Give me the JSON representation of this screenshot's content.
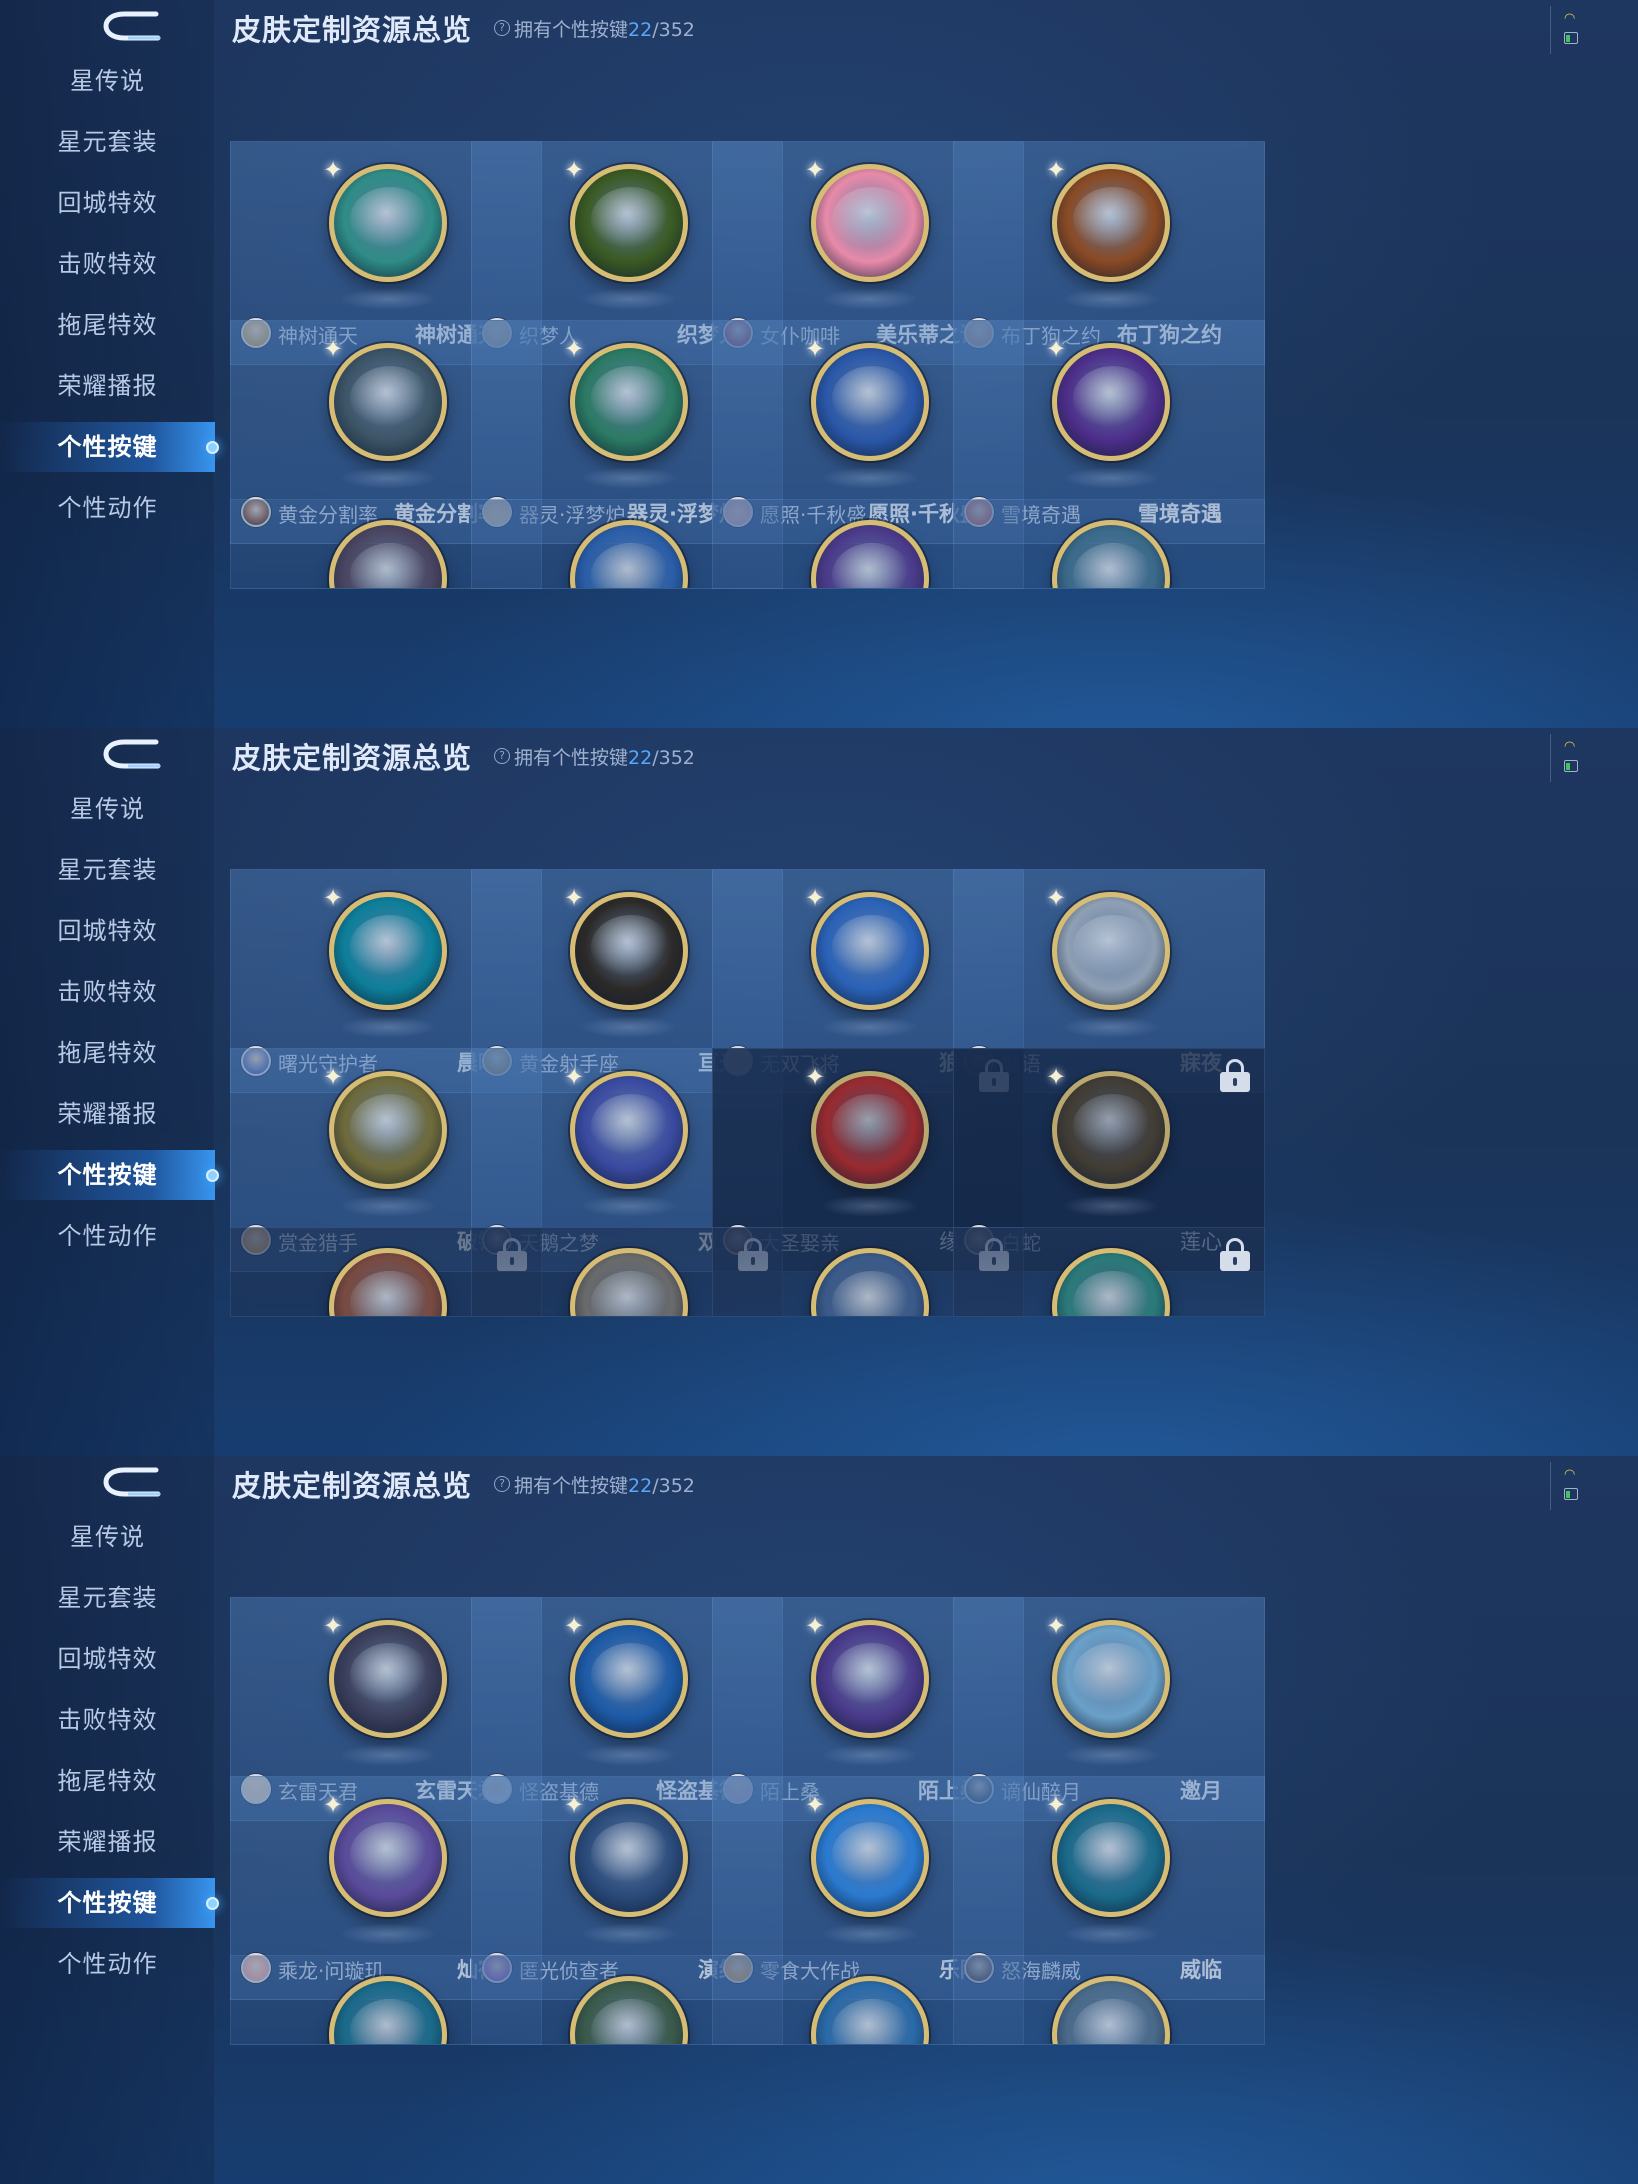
{
  "header": {
    "title": "皮肤定制资源总览",
    "help_icon": "question-icon",
    "owned_prefix": "拥有个性按键",
    "owned_count": "22",
    "owned_total": "/352"
  },
  "sidebar": {
    "back_icon": "back-arrow-icon",
    "items": [
      {
        "label": "星传说"
      },
      {
        "label": "星元套装"
      },
      {
        "label": "回城特效"
      },
      {
        "label": "击败特效"
      },
      {
        "label": "拖尾特效"
      },
      {
        "label": "荣耀播报"
      },
      {
        "label": "个性按键",
        "active": true
      },
      {
        "label": "个性动作"
      }
    ]
  },
  "status_bar": {
    "wifi_icon": "wifi-icon",
    "battery_icon": "battery-icon"
  },
  "screens": [
    {
      "cards": [
        {
          "hero": "神树通天",
          "skin": "神树通天",
          "icon": "winged-staff-icon",
          "medal": "#2f8c86",
          "avatar": "#c9a55a",
          "locked": false
        },
        {
          "hero": "织梦人",
          "skin": "织梦人",
          "icon": "golden-dragon-icon",
          "medal": "#3a5a22",
          "avatar": "#d4b48a",
          "locked": false
        },
        {
          "hero": "女仆咖啡",
          "skin": "美乐蒂之语",
          "icon": "melody-bunny-icon",
          "medal": "#e88aa9",
          "avatar": "#c0304a",
          "locked": false
        },
        {
          "hero": "布丁狗之约",
          "skin": "布丁狗之约",
          "icon": "pudding-bow-icon",
          "medal": "#8a4a24",
          "avatar": "#e39a7a",
          "locked": false
        },
        {
          "hero": "黄金分割率",
          "skin": "黄金分割率",
          "icon": "compass-ruler-icon",
          "medal": "#3c5466",
          "avatar": "#7b4a34",
          "locked": false
        },
        {
          "hero": "器灵·浮梦炉",
          "skin": "器灵·浮梦炉",
          "icon": "golden-censer-icon",
          "medal": "#2b7a63",
          "avatar": "#e3d2b0",
          "locked": false
        },
        {
          "hero": "愿照·千秋盛",
          "skin": "愿照·千秋盛",
          "icon": "pinwheel-icon",
          "medal": "#2a57a8",
          "avatar": "#e0b4c0",
          "locked": false
        },
        {
          "hero": "雪境奇遇",
          "skin": "雪境奇遇",
          "icon": "purple-flower-icon",
          "medal": "#4d2e8a",
          "avatar": "#d96b6b",
          "locked": false
        }
      ],
      "peek": [
        {
          "icon": "golden-spear-icon",
          "medal": "#4a4560",
          "locked": false
        },
        {
          "icon": "gauntlet-icon",
          "medal": "#2a5ea8",
          "locked": false
        },
        {
          "icon": "purple-dragon-icon",
          "medal": "#4b3a8a",
          "locked": false
        },
        {
          "icon": "trident-icon",
          "medal": "#3a6a8a",
          "locked": false
        }
      ]
    },
    {
      "cards": [
        {
          "hero": "曙光守护者",
          "skin": "晨晖",
          "icon": "blue-axe-icon",
          "medal": "#0d7f9a",
          "avatar": "#5a6ab0",
          "locked": false
        },
        {
          "hero": "黄金射手座",
          "skin": "亘光",
          "icon": "golden-bow-icon",
          "medal": "#2c2a28",
          "avatar": "#b88a3a",
          "locked": false
        },
        {
          "hero": "无双飞将",
          "skin": "狼魂",
          "icon": "spear-blade-icon",
          "medal": "#2a62b8",
          "avatar": "#e6e6f0",
          "locked": false
        },
        {
          "hero": "魅语",
          "skin": "寐夜",
          "icon": "folding-fan-icon",
          "medal": "#8fa0b4",
          "avatar": "#5a4a58",
          "locked": false
        },
        {
          "hero": "赏金猎手",
          "skin": "破锋",
          "icon": "golden-blade-icon",
          "medal": "#6e6a3a",
          "avatar": "#c8a06a",
          "locked": false
        },
        {
          "hero": "天鹅之梦",
          "skin": "双生",
          "icon": "swan-moon-icon",
          "medal": "#3a4aa0",
          "avatar": "#3a4a8a",
          "locked": false
        },
        {
          "hero": "大圣娶亲",
          "skin": "缘起",
          "icon": "red-scroll-icon",
          "medal": "#b02a2a",
          "avatar": "#9a4a34",
          "locked": true
        },
        {
          "hero": "白蛇",
          "skin": "莲心",
          "icon": "lotus-icon",
          "medal": "#4a4030",
          "avatar": "#6a5a50",
          "locked": true
        }
      ],
      "peek": [
        {
          "icon": "compass-icon",
          "medal": "#7a4a40",
          "locked": true
        },
        {
          "icon": "staff-icon",
          "medal": "#6a6a6a",
          "locked": true
        },
        {
          "icon": "wing-icon",
          "medal": "#3a5a8a",
          "locked": true
        },
        {
          "icon": "teal-crest-icon",
          "medal": "#2a7a7a",
          "locked": true
        }
      ]
    },
    {
      "cards": [
        {
          "hero": "玄雷天君",
          "skin": "玄雷天君",
          "icon": "thunder-spear-icon",
          "medal": "#3a3e5a",
          "avatar": "#e3d2c0",
          "locked": false
        },
        {
          "hero": "怪盗基德",
          "skin": "怪盗基德",
          "icon": "kid-cannon-icon",
          "medal": "#1d5aa6",
          "avatar": "#f0f0f0",
          "locked": false
        },
        {
          "hero": "陌上桑",
          "skin": "陌上桑",
          "icon": "silk-ribbon-icon",
          "medal": "#4a3a8a",
          "avatar": "#e0b8d8",
          "locked": false
        },
        {
          "hero": "谪仙醉月",
          "skin": "邀月",
          "icon": "moon-sword-icon",
          "medal": "#6aa0c8",
          "avatar": "#3a3a4a",
          "locked": false
        },
        {
          "hero": "乘龙·问璇玑",
          "skin": "灿宿",
          "icon": "celestial-dragon-icon",
          "medal": "#5a4a9a",
          "avatar": "#e0a8a8",
          "locked": false
        },
        {
          "hero": "匿光侦查者",
          "skin": "演绎",
          "icon": "crossbow-icon",
          "medal": "#2a4a7a",
          "avatar": "#9a6ad0",
          "locked": false
        },
        {
          "hero": "零食大作战",
          "skin": "乐陶",
          "icon": "red-panda-icon",
          "medal": "#2a7ad0",
          "avatar": "#e8a858",
          "locked": false
        },
        {
          "hero": "怒海麟威",
          "skin": "威临",
          "icon": "ocean-trident-icon",
          "medal": "#1a6a8a",
          "avatar": "#6a5a5a",
          "locked": false
        }
      ],
      "peek": [
        {
          "icon": "teal-blade-icon",
          "medal": "#1a6a8a",
          "locked": false
        },
        {
          "icon": "golden-crest-icon",
          "medal": "#3a5a4a",
          "locked": false
        },
        {
          "icon": "ice-blade-icon",
          "medal": "#2a6aa8",
          "locked": false
        },
        {
          "icon": "silver-staff-icon",
          "medal": "#4a6a8a",
          "locked": false
        }
      ]
    }
  ]
}
